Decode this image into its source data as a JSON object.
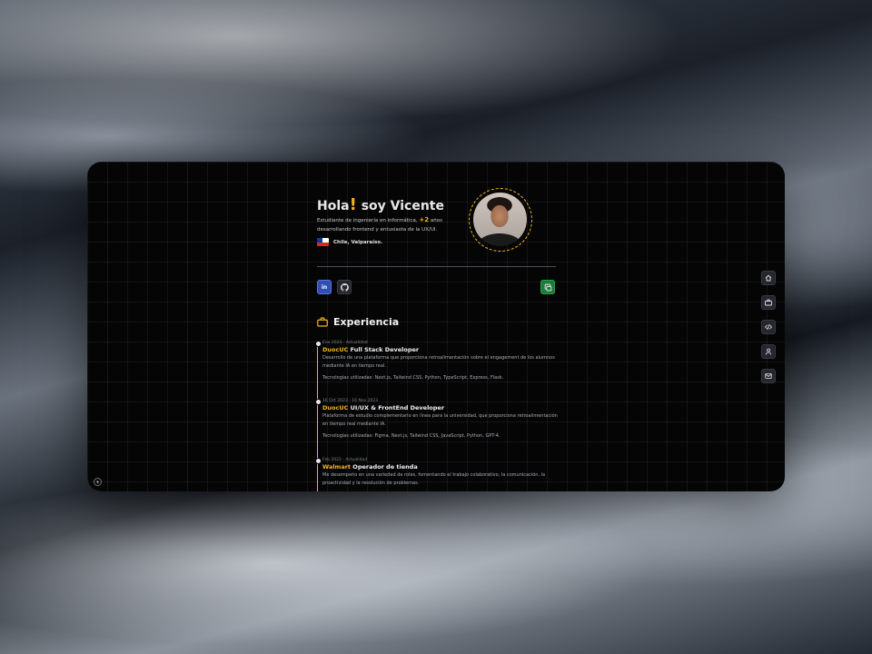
{
  "hero": {
    "greeting": "Hola",
    "exclamation": "!",
    "name": "soy Vicente",
    "bio_before": "Estudiante de ingeniería en informática, ",
    "bio_highlight": "+2",
    "bio_after": " años desarrollando frontend y entusiasta de la UX/UI.",
    "location": "Chile, Valparaíso.",
    "flag_icon": "chile-flag-icon",
    "avatar_icon": "profile-photo"
  },
  "social": {
    "linkedin_label": "in",
    "github_icon": "github-icon",
    "cv_icon": "cv-download-icon"
  },
  "experience": {
    "title": "Experiencia",
    "icon": "briefcase-icon",
    "items": [
      {
        "date": "Ene 2024 - Actualidad",
        "company": "DuocUC",
        "role": " Full Stack Developer",
        "description": "Desarrollo de una plataforma que proporciona retroalimentación sobre el engagement de los alumnos mediante IA en tiempo real.",
        "tech": "Tecnologías utilizadas: Next.js, Tailwind CSS, Python, TypeScript, Express, Flask."
      },
      {
        "date": "16 Oct 2023 - 16 Nov 2023",
        "company": "DuocUC",
        "role": " UI/UX & FrontEnd Developer",
        "description": "Plataforma de estudio complementario en línea para la universidad, que proporciona retroalimentación en tiempo real mediante IA.",
        "tech": "Tecnologías utilizadas: Figma, Next.js, Tailwind CSS, JavaScript, Python, GPT-4."
      },
      {
        "date": "Feb 2022 - Actualidad",
        "company": "Walmart",
        "role": " Operador de tienda",
        "description": "Me desempeño en una variedad de roles, fomentando el trabajo colaborativo, la comunicación, la proactividad y la resolución de problemas.",
        "tech": ""
      }
    ]
  },
  "side_nav": [
    "home-icon",
    "briefcase-icon",
    "code-icon",
    "user-icon",
    "mail-icon"
  ],
  "colors": {
    "accent": "#f5b41a",
    "linkedin": "#2f4fb5",
    "cv": "#1e7a3a",
    "background": "#050505"
  }
}
